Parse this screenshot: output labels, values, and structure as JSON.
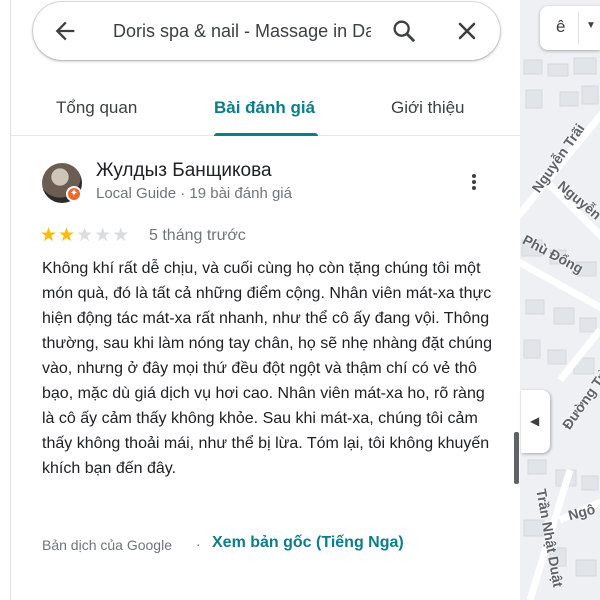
{
  "search": {
    "query": "Doris spa & nail - Massage in Da Nang"
  },
  "tabs": [
    {
      "label": "Tổng quan",
      "active": false
    },
    {
      "label": "Bài đánh giá",
      "active": true
    },
    {
      "label": "Giới thiệu",
      "active": false
    }
  ],
  "review": {
    "reviewer_name": "Жулдыз Банщикова",
    "reviewer_meta": "Local Guide · 19 bài đánh giá",
    "rating": 2,
    "max_rating": 5,
    "date": "5 tháng trước",
    "text": "Không khí rất dễ chịu, và cuối cùng họ còn tặng chúng tôi một món quà, đó là tất cả những điểm cộng. Nhân viên mát-xa thực hiện động tác mát-xa rất nhanh, như thể cô ấy đang vội. Thông thường, sau khi làm nóng tay chân, họ sẽ nhẹ nhàng đặt chúng vào, nhưng ở đây mọi thứ đều đột ngột và thậm chí có vẻ thô bạo, mặc dù giá dịch vụ hơi cao. Nhân viên mát-xa ho, rõ ràng là cô ấy cảm thấy không khỏe. Sau khi mát-xa, chúng tôi cảm thấy không thoải mái, như thể bị lừa. Tóm lại, tôi không khuyến khích bạn đến đây.",
    "translation_note": "Bản dịch của Google",
    "separator": "·",
    "view_original": "Xem bản gốc (Tiếng Nga)"
  },
  "map": {
    "labels": [
      "Nguyễn Trãi",
      "Nguyễn",
      "Phù Đổng",
      "Đường Trầ",
      "Trần Nhật Duật",
      "Ngô"
    ],
    "layer_glyph": "ê"
  },
  "colors": {
    "accent": "#0b7e8a",
    "star_filled": "#fbbc04",
    "star_empty": "#dadce0"
  }
}
